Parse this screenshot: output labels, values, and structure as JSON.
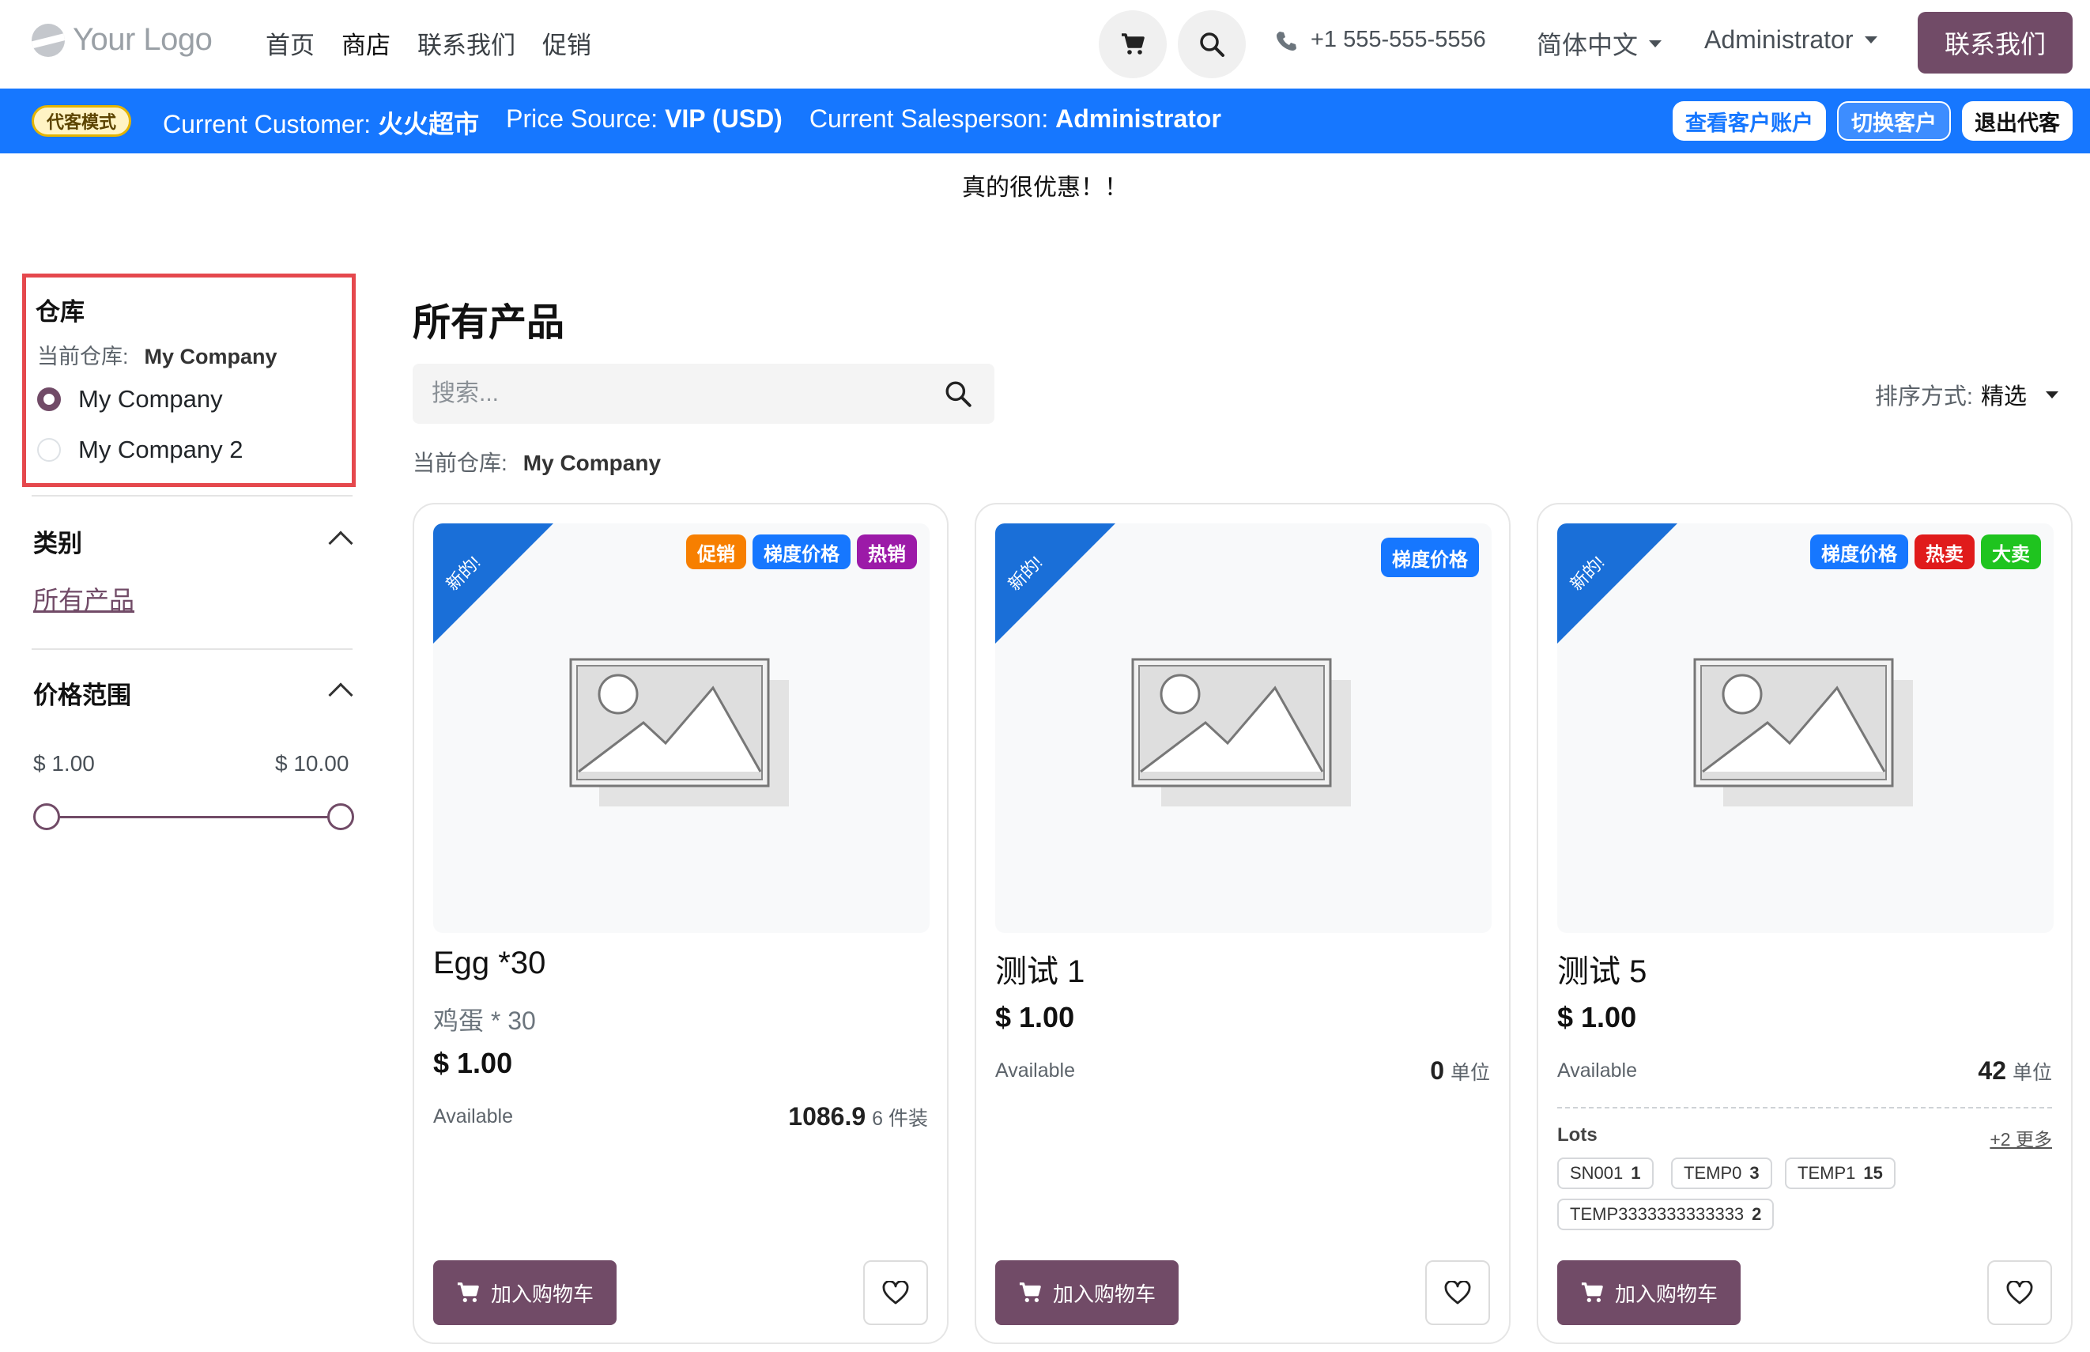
{
  "navbar": {
    "logo_text": "Your Logo",
    "links": [
      "首页",
      "商店",
      "联系我们",
      "促销"
    ],
    "active_link": "商店",
    "phone": "+1 555-555-5556",
    "language": "简体中文",
    "user": "Administrator",
    "contact_button": "联系我们"
  },
  "proxy_bar": {
    "badge": "代客模式",
    "customer_label": "Current Customer:",
    "customer_value": "火火超市",
    "price_source_label": "Price Source:",
    "price_source_value": "VIP (USD)",
    "salesperson_label": "Current Salesperson:",
    "salesperson_value": "Administrator",
    "actions": [
      "查看客户账户",
      "切换客户",
      "退出代客"
    ]
  },
  "promo_text": "真的很优惠！！",
  "sidebar": {
    "warehouse_title": "仓库",
    "current_label": "当前仓库:",
    "current_value": "My Company",
    "warehouses": [
      "My Company",
      "My Company 2"
    ],
    "selected_warehouse": "My Company",
    "category_title": "类别",
    "category_link": "所有产品",
    "price_title": "价格范围",
    "price_min": "$ 1.00",
    "price_max": "$ 10.00"
  },
  "main": {
    "title": "所有产品",
    "search_placeholder": "搜索...",
    "sort_label": "排序方式:",
    "sort_value": "精选",
    "current_label": "当前仓库:",
    "current_value": "My Company"
  },
  "products": [
    {
      "ribbon": "新的!",
      "tags": [
        {
          "label": "促销",
          "color": "#f77f00"
        },
        {
          "label": "梯度价格",
          "color": "#1677ff"
        },
        {
          "label": "热销",
          "color": "#9c1aa8"
        }
      ],
      "name": "Egg *30",
      "subtitle": "鸡蛋 * 30",
      "price": "$ 1.00",
      "available_label": "Available",
      "qty": "1086.9",
      "unit": "6 件装",
      "cart_label": "加入购物车"
    },
    {
      "ribbon": "新的!",
      "tags": [
        {
          "label": "梯度价格",
          "color": "#1677ff"
        }
      ],
      "name": "测试 1",
      "subtitle": "",
      "price": "$ 1.00",
      "available_label": "Available",
      "qty": "0",
      "unit": "单位",
      "cart_label": "加入购物车"
    },
    {
      "ribbon": "新的!",
      "tags": [
        {
          "label": "梯度价格",
          "color": "#1677ff"
        },
        {
          "label": "热卖",
          "color": "#e01b1b"
        },
        {
          "label": "大卖",
          "color": "#1fc41f"
        }
      ],
      "name": "测试 5",
      "subtitle": "",
      "price": "$ 1.00",
      "available_label": "Available",
      "qty": "42",
      "unit": "单位",
      "lots_title": "Lots",
      "lots_more": "+2 更多",
      "lots": [
        {
          "code": "SN001",
          "qty": "1"
        },
        {
          "code": "TEMP0",
          "qty": "3"
        },
        {
          "code": "TEMP1",
          "qty": "15"
        },
        {
          "code": "TEMP3333333333333",
          "qty": "2"
        }
      ],
      "cart_label": "加入购物车"
    }
  ]
}
